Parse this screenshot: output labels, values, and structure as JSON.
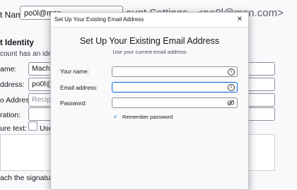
{
  "background": {
    "header_label": "t Name:",
    "account_name_value": "po0l@msn",
    "page_title": "ount Settings - <po0l@msn.com>",
    "section_title": "t Identity",
    "subtext": "count has an identity,",
    "name_label": "ame:",
    "name_value": "Machin",
    "email_label": "ddress:",
    "email_value": "po0l@msn",
    "reply_label": "o Address:",
    "reply_placeholder": "Recipies",
    "org_label": "ration:",
    "sig_label": "ure text:",
    "use_html_label": "Use H",
    "attach_sig_label": "ach the signature fro"
  },
  "dialog": {
    "title": "Set Up Your Existing Email Address",
    "close_glyph": "✕",
    "heading": "Set Up Your Existing Email Address",
    "subheading": "Use your current email address",
    "fields": {
      "name_label": "Your name:",
      "name_value": "",
      "email_label": "Email address:",
      "email_value": "",
      "password_label": "Password:",
      "password_value": ""
    },
    "remember_label": "Remember password",
    "remember_checked": true,
    "info_glyph": "i",
    "icons": [
      "info-icon",
      "eye-slash-icon",
      "close-icon",
      "checkmark-icon"
    ]
  },
  "colors": {
    "accent": "#0061e0",
    "border": "#8f8f9d"
  }
}
